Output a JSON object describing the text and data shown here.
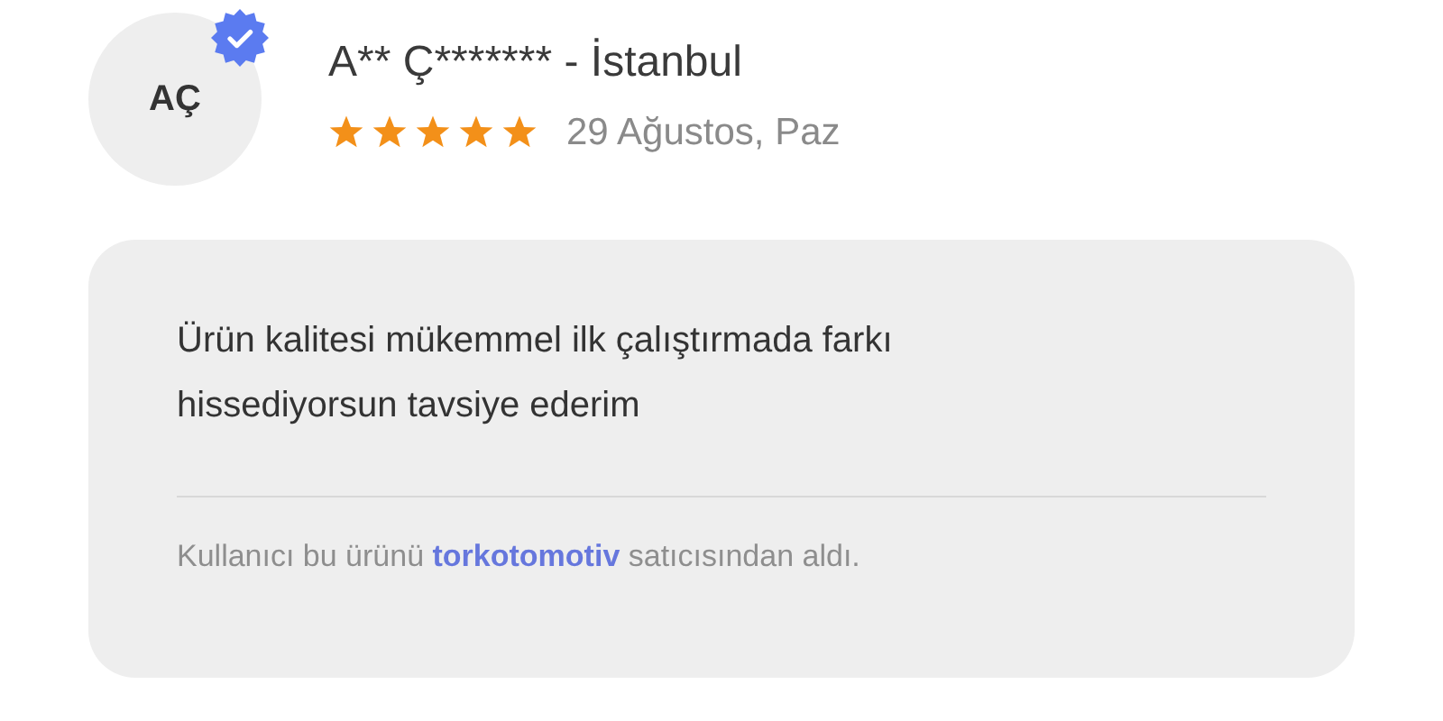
{
  "reviewer": {
    "initials": "AÇ",
    "verified": true,
    "name": "A** Ç******* - İstanbul"
  },
  "rating": {
    "stars": 5,
    "date": "29 Ağustos, Paz"
  },
  "review": {
    "text": "Ürün kalitesi mükemmel ilk çalıştırmada farkı hissediyorsun tavsiye ederim",
    "purchase_note": {
      "before": "Kullanıcı bu ürünü",
      "seller": "torkotomotiv",
      "after": "satıcısından aldı."
    }
  }
}
